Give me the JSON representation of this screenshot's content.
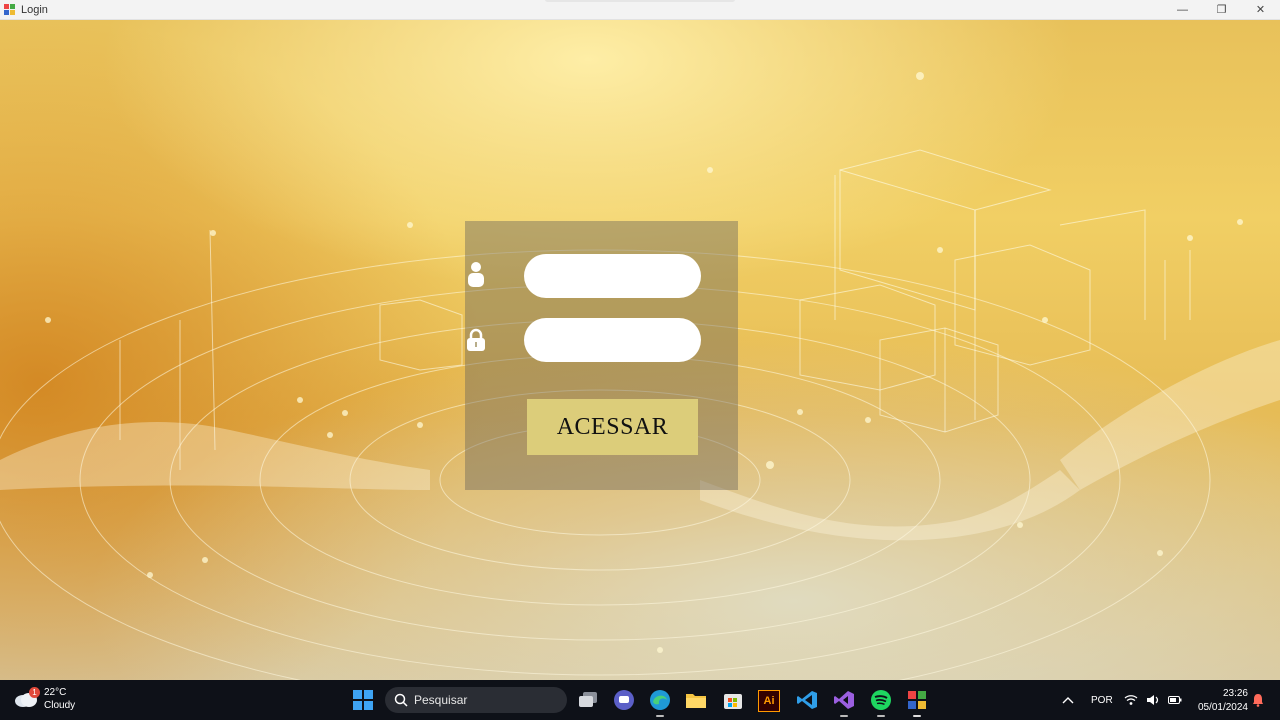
{
  "window": {
    "title": "Login",
    "controls": {
      "minimize": "—",
      "restore": "❐",
      "close": "✕"
    }
  },
  "login": {
    "username_placeholder": "",
    "password_placeholder": "",
    "username_icon": "user-icon",
    "password_icon": "lock-icon",
    "submit_label": "ACESSAR"
  },
  "taskbar": {
    "weather": {
      "badge": "1",
      "temperature": "22°C",
      "condition": "Cloudy"
    },
    "search_placeholder": "Pesquisar",
    "apps": [
      "task-view",
      "teams",
      "edge",
      "file-explorer",
      "microsoft-store",
      "adobe-illustrator",
      "vs-code",
      "visual-studio",
      "spotify",
      "winforms-app"
    ],
    "illustrator_label": "Ai",
    "language": "POR",
    "time": "23:26",
    "date": "05/01/2024"
  },
  "colors": {
    "button": "#dccd7a",
    "panel": "rgba(110,105,90,0.45)",
    "taskbar": "#0e1118",
    "accent": "#3ea4f4"
  }
}
